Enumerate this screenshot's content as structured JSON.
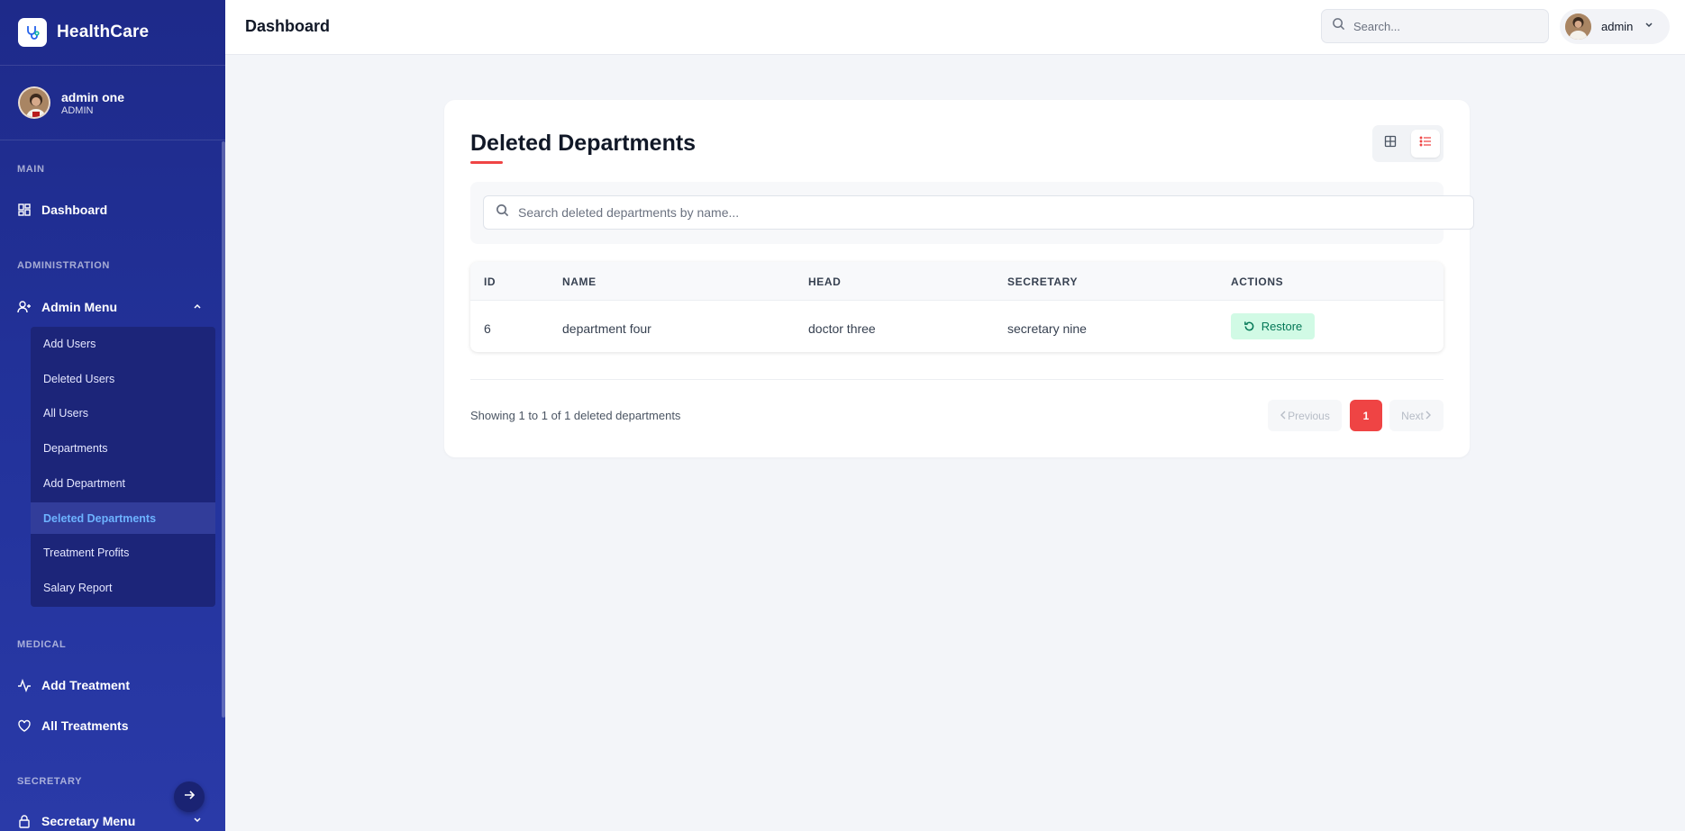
{
  "app": {
    "name": "HealthCare"
  },
  "profile": {
    "name": "admin one",
    "role": "ADMIN"
  },
  "sidebar": {
    "sections": {
      "main": "MAIN",
      "administration": "ADMINISTRATION",
      "medical": "MEDICAL",
      "secretary": "SECRETARY"
    },
    "dashboard": "Dashboard",
    "admin_menu": "Admin Menu",
    "admin_items": [
      "Add Users",
      "Deleted Users",
      "All Users",
      "Departments",
      "Add Department",
      "Deleted Departments",
      "Treatment Profits",
      "Salary Report"
    ],
    "active_item": "Deleted Departments",
    "add_treatment": "Add Treatment",
    "all_treatments": "All Treatments",
    "secretary_menu": "Secretary Menu"
  },
  "header": {
    "title": "Dashboard",
    "search_placeholder": "Search...",
    "user": "admin"
  },
  "page": {
    "title": "Deleted Departments",
    "search_placeholder": "Search deleted departments by name...",
    "columns": [
      "ID",
      "NAME",
      "HEAD",
      "SECRETARY",
      "ACTIONS"
    ],
    "rows": [
      {
        "id": "6",
        "name": "department four",
        "head": "doctor three",
        "secretary": "secretary nine",
        "action": "Restore"
      }
    ],
    "showing": "Showing 1 to 1 of 1 deleted departments",
    "pagination": {
      "previous": "Previous",
      "current": "1",
      "next": "Next"
    }
  },
  "colors": {
    "sidebar": "#1e2a8a",
    "accent": "#ef4444",
    "restore_bg": "#d1fae5",
    "restore_text": "#047857",
    "active_link": "#6db3ff"
  }
}
